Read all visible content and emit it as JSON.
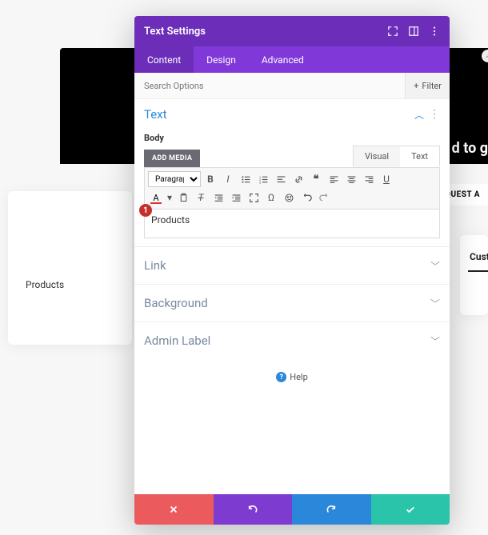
{
  "background": {
    "dark_text": "d to g",
    "dark_button": "REQUEST A",
    "products_label": "Products",
    "custo_label": "Custo"
  },
  "modal": {
    "title": "Text Settings",
    "tabs": {
      "content": "Content",
      "design": "Design",
      "advanced": "Advanced"
    },
    "search_placeholder": "Search Options",
    "filter_label": "Filter",
    "sections": {
      "text": {
        "title": "Text",
        "field_label": "Body"
      },
      "link": {
        "title": "Link"
      },
      "background": {
        "title": "Background"
      },
      "admin_label": {
        "title": "Admin Label"
      }
    },
    "editor": {
      "add_media": "ADD MEDIA",
      "tab_visual": "Visual",
      "tab_text": "Text",
      "format_select": "Paragraph",
      "content": "Products",
      "badge": "1"
    },
    "help": "Help"
  }
}
